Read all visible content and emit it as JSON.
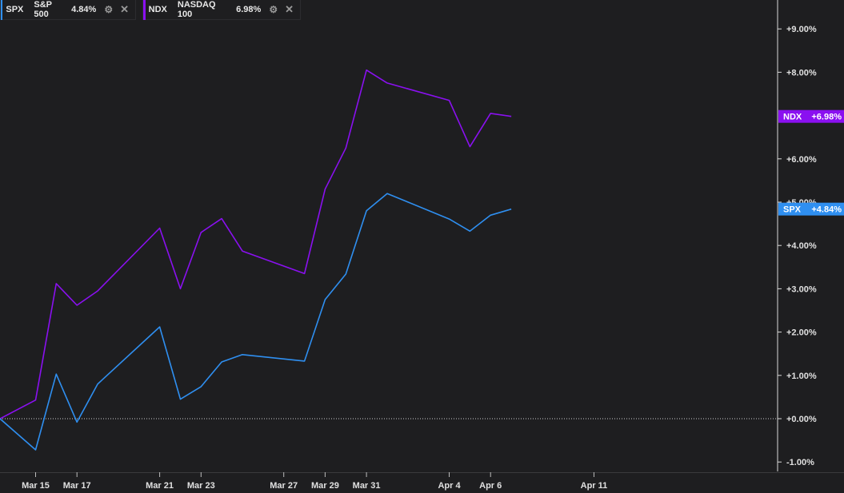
{
  "legend": [
    {
      "symbol": "SPX",
      "name": "S&P 500",
      "value": "4.84%",
      "color": "#2f8ff0"
    },
    {
      "symbol": "NDX",
      "name": "NASDAQ 100",
      "value": "6.98%",
      "color": "#8a10f0"
    }
  ],
  "chart_data": {
    "type": "line",
    "x": [
      "Mar 14",
      "Mar 15",
      "Mar 16",
      "Mar 17",
      "Mar 18",
      "Mar 21",
      "Mar 22",
      "Mar 23",
      "Mar 24",
      "Mar 25",
      "Mar 28",
      "Mar 29",
      "Mar 30",
      "Mar 31",
      "Apr 1",
      "Apr 4",
      "Apr 5",
      "Apr 6",
      "Apr 7"
    ],
    "x_ticks": [
      "Mar 15",
      "Mar 17",
      "Mar 21",
      "Mar 23",
      "Mar 27",
      "Mar 29",
      "Mar 31",
      "Apr 4",
      "Apr 6",
      "Apr 11"
    ],
    "series": [
      {
        "name": "NASDAQ 100",
        "symbol": "NDX",
        "color": "#8a10f0",
        "values": [
          0.0,
          0.43,
          3.12,
          2.62,
          2.95,
          4.4,
          3.0,
          4.3,
          4.62,
          3.87,
          3.35,
          5.3,
          6.25,
          8.05,
          7.75,
          7.35,
          6.28,
          7.05,
          6.98
        ],
        "label": "NDX",
        "label_value": "+6.98%"
      },
      {
        "name": "S&P 500",
        "symbol": "SPX",
        "color": "#2f8ff0",
        "values": [
          0.0,
          -0.72,
          1.03,
          -0.08,
          0.8,
          2.12,
          0.45,
          0.74,
          1.31,
          1.48,
          1.33,
          2.75,
          3.34,
          4.8,
          5.2,
          4.61,
          4.33,
          4.7,
          4.84
        ],
        "label": "SPX",
        "label_value": "+4.84%"
      }
    ],
    "y_ticks": [
      "-1.00%",
      "+0.00%",
      "+1.00%",
      "+2.00%",
      "+3.00%",
      "+4.00%",
      "+5.00%",
      "+6.00%",
      "+8.00%",
      "+9.00%"
    ],
    "ylim": [
      -1.0,
      9.0
    ],
    "zero_line": true,
    "grid": false,
    "legend_position": "top-left"
  }
}
